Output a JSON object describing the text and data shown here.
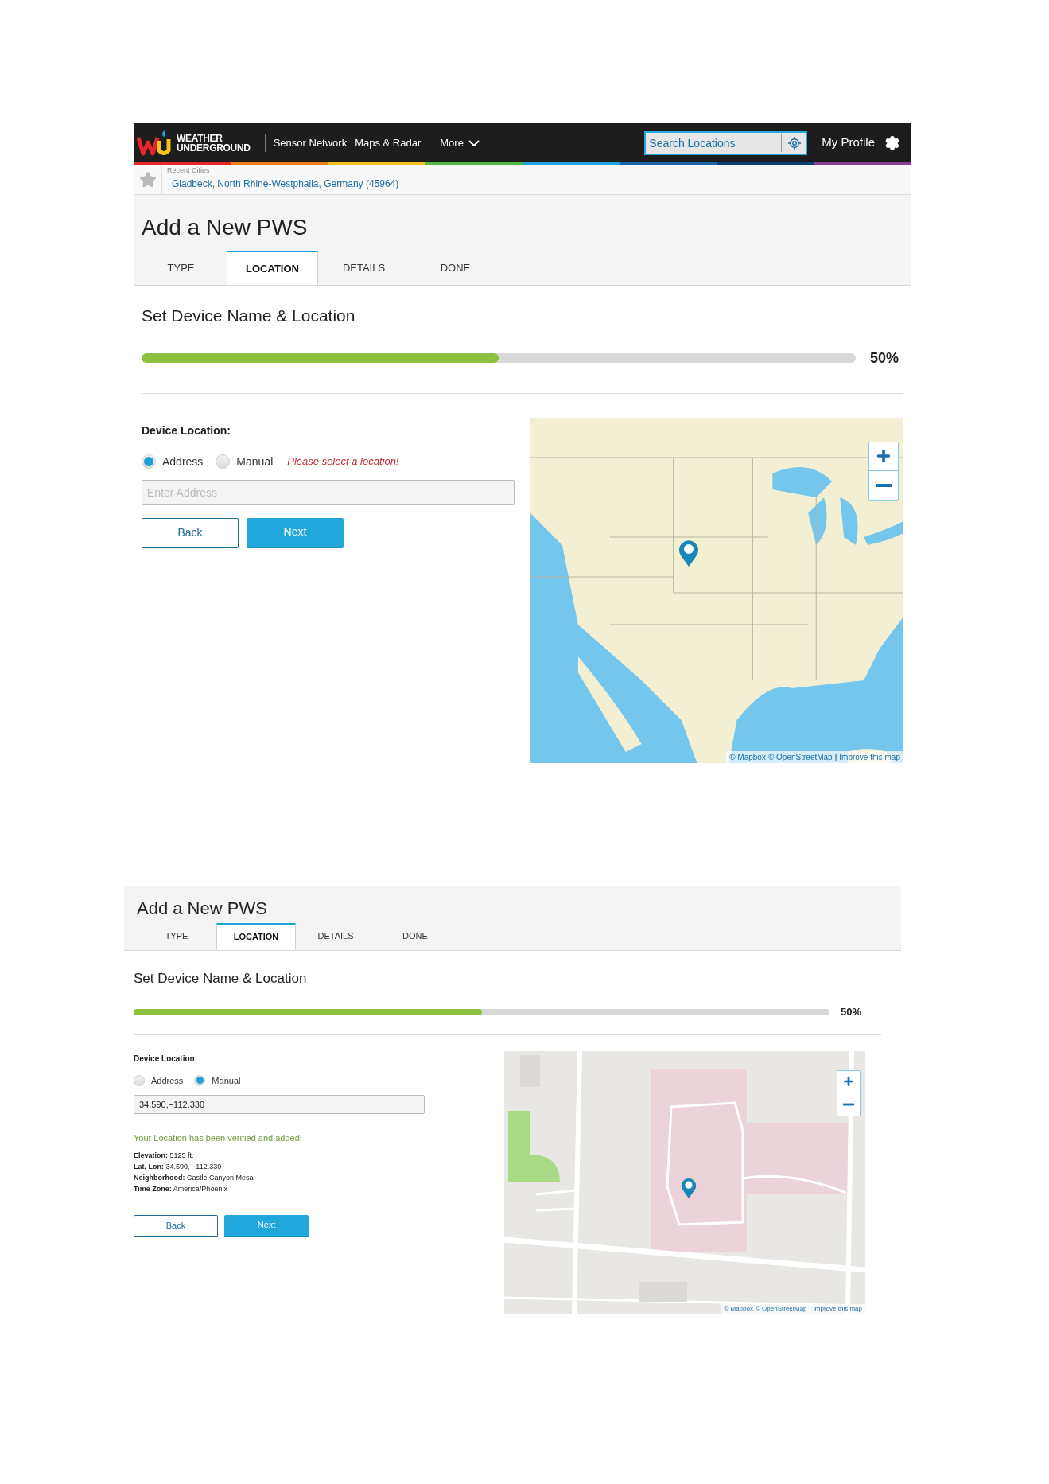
{
  "screens": [
    {
      "kind": "full",
      "header": {
        "logo_text": [
          "WEATHER",
          "UNDERGROUND"
        ],
        "nav": [
          "Sensor Network",
          "Maps & Radar",
          "More"
        ],
        "search": {
          "placeholder": "Search Locations"
        },
        "profile": "My Profile"
      },
      "recent": {
        "label": "Recent Cities",
        "city": "Gladbeck, North Rhine-Westphalia, Germany (45964)"
      },
      "page_title": "Add a New PWS",
      "tabs": [
        {
          "label": "TYPE",
          "selected": false
        },
        {
          "label": "LOCATION",
          "selected": true
        },
        {
          "label": "DETAILS",
          "selected": false
        },
        {
          "label": "DONE",
          "selected": false
        }
      ],
      "section_title": "Set Device Name & Location",
      "progress": {
        "level": 0.5,
        "reading": "50%"
      },
      "form": {
        "label": "Device Location:",
        "radios": [
          {
            "label": "Address",
            "selected": true
          },
          {
            "label": "Manual",
            "selected": false
          }
        ],
        "error": "Please select a location!",
        "field": {
          "placeholder": "Enter Address"
        },
        "buttons": [
          "Back",
          "Next"
        ]
      },
      "map": {
        "attribution": [
          "© Mapbox",
          "© OpenStreetMap",
          "|",
          "Improve this map"
        ]
      }
    },
    {
      "kind": "compact",
      "page_title": "Add a New PWS",
      "tabs": [
        {
          "label": "TYPE",
          "selected": false
        },
        {
          "label": "LOCATION",
          "selected": true
        },
        {
          "label": "DETAILS",
          "selected": false
        },
        {
          "label": "DONE",
          "selected": false
        }
      ],
      "section_title": "Set Device Name & Location",
      "progress": {
        "level": 0.5,
        "reading": "50%"
      },
      "form": {
        "label": "Device Location:",
        "radios": [
          {
            "label": "Address",
            "selected": false
          },
          {
            "label": "Manual",
            "selected": true
          }
        ],
        "field": {
          "value": "34.590,−112.330"
        },
        "success": "Your Location has been verified and added!",
        "details": [
          {
            "label": "Elevation:",
            "value": "5125 ft."
          },
          {
            "label": "Lat, Lon:",
            "value": "34.590, −112.330"
          },
          {
            "label": "Neighborhood:",
            "value": "Castle Canyon Mesa"
          },
          {
            "label": "Time Zone:",
            "value": "America/Phoenix"
          }
        ],
        "buttons": [
          "Back",
          "Next"
        ]
      },
      "map": {
        "attribution": [
          "© Mapbox",
          "© OpenStreetMap",
          "|",
          "Improve this map"
        ]
      }
    }
  ]
}
